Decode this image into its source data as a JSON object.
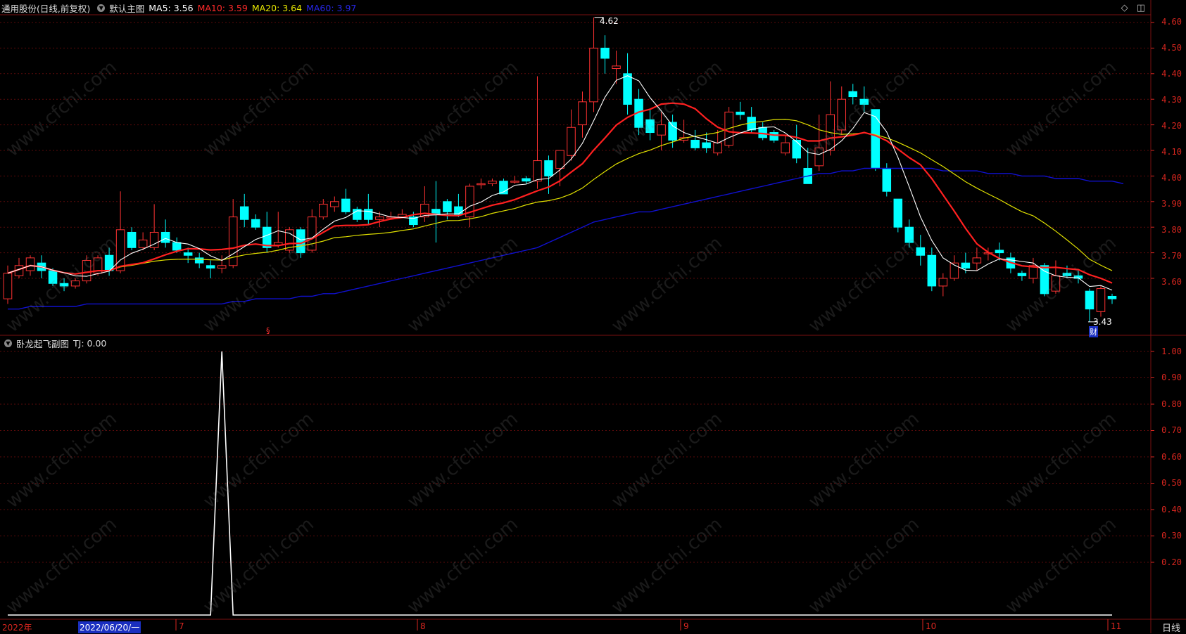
{
  "main_header": {
    "stock": "通用股份(日线,前复权)",
    "indicator_name": "默认主图",
    "ma5": "MA5: 3.56",
    "ma10": "MA10: 3.59",
    "ma20": "MA20: 3.64",
    "ma60": "MA60: 3.97"
  },
  "sub_header": {
    "indicator_name": "卧龙起飞副图",
    "tj": "TJ: 0.00"
  },
  "main_axis": [
    "4.60",
    "4.50",
    "4.40",
    "4.30",
    "4.20",
    "4.10",
    "4.00",
    "3.90",
    "3.80",
    "3.70",
    "3.60"
  ],
  "sub_axis": [
    "1.00",
    "0.90",
    "0.80",
    "0.70",
    "0.60",
    "0.50",
    "0.40",
    "0.30",
    "0.20"
  ],
  "x_labels": {
    "year": "2022年",
    "cursor_date": "2022/06/20/一",
    "m7": "7",
    "m8": "8",
    "m9": "9",
    "m10": "10",
    "m11": "11"
  },
  "annotations": {
    "high": "4.62",
    "low": "3.43",
    "fin_marker": "财",
    "section_marker": "§"
  },
  "period_label": "日线",
  "watermark": "www.cfchi.com",
  "colors": {
    "up": "#ff3232",
    "down": "#00ffff",
    "ma5": "#ffffff",
    "ma10": "#ff2020",
    "ma20": "#e0e000",
    "ma60": "#1010d0",
    "axis": "#d8261f"
  },
  "chart_data": {
    "type": "candlestick",
    "y_range": [
      3.43,
      4.62
    ],
    "candles": [
      [
        3.52,
        3.62,
        3.5,
        3.65
      ],
      [
        3.61,
        3.65,
        3.6,
        3.68
      ],
      [
        3.63,
        3.68,
        3.61,
        3.69
      ],
      [
        3.66,
        3.63,
        3.6,
        3.69
      ],
      [
        3.63,
        3.58,
        3.57,
        3.64
      ],
      [
        3.58,
        3.57,
        3.55,
        3.6
      ],
      [
        3.57,
        3.59,
        3.56,
        3.6
      ],
      [
        3.59,
        3.67,
        3.58,
        3.69
      ],
      [
        3.62,
        3.68,
        3.61,
        3.69
      ],
      [
        3.69,
        3.63,
        3.61,
        3.72
      ],
      [
        3.63,
        3.79,
        3.62,
        3.94
      ],
      [
        3.78,
        3.72,
        3.71,
        3.8
      ],
      [
        3.72,
        3.75,
        3.71,
        3.78
      ],
      [
        3.72,
        3.78,
        3.71,
        3.89
      ],
      [
        3.78,
        3.74,
        3.72,
        3.83
      ],
      [
        3.74,
        3.71,
        3.7,
        3.76
      ],
      [
        3.7,
        3.69,
        3.66,
        3.72
      ],
      [
        3.68,
        3.66,
        3.64,
        3.7
      ],
      [
        3.65,
        3.64,
        3.6,
        3.67
      ],
      [
        3.64,
        3.65,
        3.62,
        3.69
      ],
      [
        3.65,
        3.84,
        3.64,
        3.91
      ],
      [
        3.88,
        3.83,
        3.8,
        3.93
      ],
      [
        3.83,
        3.8,
        3.79,
        3.85
      ],
      [
        3.8,
        3.72,
        3.7,
        3.86
      ],
      [
        3.73,
        3.74,
        3.72,
        3.86
      ],
      [
        3.71,
        3.79,
        3.7,
        3.8
      ],
      [
        3.79,
        3.7,
        3.68,
        3.8
      ],
      [
        3.71,
        3.84,
        3.7,
        3.87
      ],
      [
        3.84,
        3.89,
        3.83,
        3.91
      ],
      [
        3.88,
        3.9,
        3.86,
        3.92
      ],
      [
        3.91,
        3.86,
        3.85,
        3.95
      ],
      [
        3.87,
        3.83,
        3.82,
        3.88
      ],
      [
        3.87,
        3.83,
        3.81,
        3.93
      ],
      [
        3.83,
        3.84,
        3.8,
        3.86
      ],
      [
        3.84,
        3.84,
        3.83,
        3.86
      ],
      [
        3.84,
        3.85,
        3.84,
        3.87
      ],
      [
        3.84,
        3.81,
        3.8,
        3.86
      ],
      [
        3.84,
        3.89,
        3.82,
        3.96
      ],
      [
        3.87,
        3.85,
        3.74,
        3.98
      ],
      [
        3.9,
        3.86,
        3.83,
        3.91
      ],
      [
        3.88,
        3.85,
        3.84,
        3.93
      ],
      [
        3.84,
        3.96,
        3.8,
        3.97
      ],
      [
        3.97,
        3.97,
        3.95,
        3.99
      ],
      [
        3.97,
        3.98,
        3.96,
        3.99
      ],
      [
        3.98,
        3.93,
        3.93,
        3.99
      ],
      [
        3.98,
        3.98,
        3.97,
        4.0
      ],
      [
        3.99,
        3.98,
        3.97,
        4.0
      ],
      [
        3.98,
        4.06,
        3.95,
        4.39
      ],
      [
        4.06,
        4.0,
        3.93,
        4.08
      ],
      [
        4.03,
        4.1,
        3.96,
        4.1
      ],
      [
        4.08,
        4.19,
        4.06,
        4.26
      ],
      [
        4.2,
        4.29,
        4.15,
        4.33
      ],
      [
        4.29,
        4.5,
        4.25,
        4.62
      ],
      [
        4.5,
        4.46,
        4.4,
        4.55
      ],
      [
        4.42,
        4.43,
        4.36,
        4.49
      ],
      [
        4.4,
        4.28,
        4.24,
        4.48
      ],
      [
        4.3,
        4.19,
        4.16,
        4.34
      ],
      [
        4.22,
        4.17,
        4.14,
        4.26
      ],
      [
        4.16,
        4.2,
        4.1,
        4.25
      ],
      [
        4.21,
        4.14,
        4.11,
        4.24
      ],
      [
        4.14,
        4.15,
        4.13,
        4.22
      ],
      [
        4.14,
        4.11,
        4.1,
        4.18
      ],
      [
        4.13,
        4.11,
        4.09,
        4.17
      ],
      [
        4.09,
        4.13,
        4.08,
        4.18
      ],
      [
        4.12,
        4.25,
        4.11,
        4.27
      ],
      [
        4.25,
        4.24,
        4.22,
        4.29
      ],
      [
        4.23,
        4.18,
        4.17,
        4.27
      ],
      [
        4.19,
        4.15,
        4.14,
        4.21
      ],
      [
        4.17,
        4.14,
        4.13,
        4.18
      ],
      [
        4.09,
        4.13,
        4.08,
        4.16
      ],
      [
        4.14,
        4.07,
        4.05,
        4.2
      ],
      [
        4.03,
        3.97,
        3.97,
        4.11
      ],
      [
        4.04,
        4.11,
        4.02,
        4.24
      ],
      [
        4.1,
        4.24,
        4.08,
        4.37
      ],
      [
        4.18,
        4.3,
        4.16,
        4.35
      ],
      [
        4.33,
        4.31,
        4.28,
        4.36
      ],
      [
        4.3,
        4.28,
        4.25,
        4.35
      ],
      [
        4.26,
        4.03,
        4.02,
        4.26
      ],
      [
        4.03,
        3.94,
        3.92,
        4.05
      ],
      [
        3.91,
        3.8,
        3.78,
        3.91
      ],
      [
        3.8,
        3.74,
        3.72,
        3.83
      ],
      [
        3.72,
        3.69,
        3.65,
        3.77
      ],
      [
        3.69,
        3.57,
        3.55,
        3.72
      ],
      [
        3.57,
        3.6,
        3.53,
        3.62
      ],
      [
        3.6,
        3.66,
        3.59,
        3.69
      ],
      [
        3.66,
        3.64,
        3.62,
        3.7
      ],
      [
        3.66,
        3.68,
        3.63,
        3.72
      ],
      [
        3.7,
        3.7,
        3.67,
        3.72
      ],
      [
        3.71,
        3.7,
        3.67,
        3.74
      ],
      [
        3.68,
        3.64,
        3.62,
        3.7
      ],
      [
        3.62,
        3.61,
        3.59,
        3.63
      ],
      [
        3.6,
        3.65,
        3.58,
        3.68
      ],
      [
        3.65,
        3.54,
        3.53,
        3.66
      ],
      [
        3.55,
        3.61,
        3.54,
        3.67
      ],
      [
        3.62,
        3.61,
        3.6,
        3.65
      ],
      [
        3.61,
        3.6,
        3.58,
        3.63
      ],
      [
        3.55,
        3.48,
        3.43,
        3.56
      ],
      [
        3.47,
        3.56,
        3.45,
        3.57
      ],
      [
        3.53,
        3.52,
        3.5,
        3.54
      ]
    ],
    "ma60": [
      3.48,
      3.48,
      3.49,
      3.49,
      3.49,
      3.49,
      3.49,
      3.5,
      3.5,
      3.5,
      3.5,
      3.5,
      3.5,
      3.5,
      3.5,
      3.5,
      3.5,
      3.5,
      3.5,
      3.5,
      3.51,
      3.51,
      3.52,
      3.52,
      3.52,
      3.52,
      3.53,
      3.53,
      3.54,
      3.54,
      3.55,
      3.56,
      3.57,
      3.58,
      3.59,
      3.6,
      3.61,
      3.62,
      3.63,
      3.64,
      3.65,
      3.66,
      3.67,
      3.68,
      3.69,
      3.7,
      3.71,
      3.72,
      3.74,
      3.76,
      3.78,
      3.8,
      3.82,
      3.83,
      3.84,
      3.85,
      3.86,
      3.86,
      3.87,
      3.88,
      3.89,
      3.9,
      3.91,
      3.92,
      3.93,
      3.94,
      3.95,
      3.96,
      3.97,
      3.98,
      3.99,
      4.0,
      4.01,
      4.01,
      4.02,
      4.02,
      4.03,
      4.03,
      4.03,
      4.03,
      4.03,
      4.03,
      4.03,
      4.02,
      4.02,
      4.02,
      4.02,
      4.01,
      4.01,
      4.01,
      4.0,
      4.0,
      4.0,
      3.99,
      3.99,
      3.99,
      3.98,
      3.98,
      3.98,
      3.97
    ]
  },
  "sub_chart": {
    "type": "line",
    "series": "TJ",
    "values_note": "zero everywhere except one spike of 1.00",
    "spike_index": 19,
    "spike_value": 1.0
  }
}
